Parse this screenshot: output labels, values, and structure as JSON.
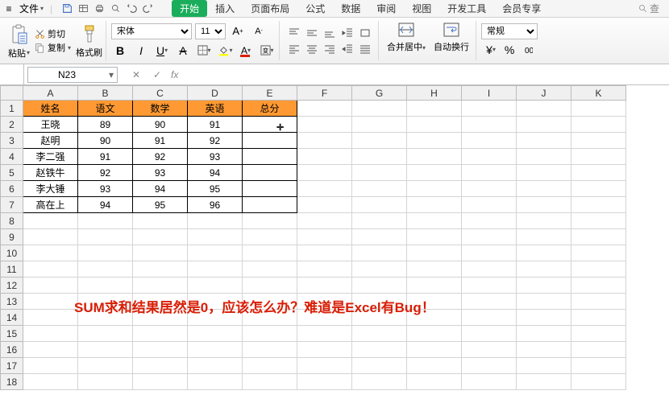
{
  "menubar": {
    "file_label": "文件",
    "quick": {
      "save": "save",
      "undo": "undo",
      "redo": "redo",
      "print": "print"
    },
    "tabs": [
      "开始",
      "插入",
      "页面布局",
      "公式",
      "数据",
      "审阅",
      "视图",
      "开发工具",
      "会员专享"
    ],
    "active_tab_index": 0,
    "search_label": "查"
  },
  "ribbon": {
    "paste_label": "粘贴",
    "cut_label": "剪切",
    "copy_label": "复制",
    "format_painter_label": "格式刷",
    "font_name": "宋体",
    "font_size": "11",
    "merge_label": "合并居中",
    "wrap_label": "自动换行",
    "number_format_label": "常规"
  },
  "namebox": {
    "cell_ref": "N23",
    "fx_label": "fx"
  },
  "grid": {
    "col_headers": [
      "A",
      "B",
      "C",
      "D",
      "E",
      "F",
      "G",
      "H",
      "I",
      "J",
      "K"
    ],
    "row_count": 18,
    "data": {
      "headers": [
        "姓名",
        "语文",
        "数学",
        "英语",
        "总分"
      ],
      "rows": [
        {
          "name": "王晓",
          "chinese": "89",
          "math": "90",
          "english": "91",
          "total": ""
        },
        {
          "name": "赵明",
          "chinese": "90",
          "math": "91",
          "english": "92",
          "total": ""
        },
        {
          "name": "李二强",
          "chinese": "91",
          "math": "92",
          "english": "93",
          "total": ""
        },
        {
          "name": "赵铁牛",
          "chinese": "92",
          "math": "93",
          "english": "94",
          "total": ""
        },
        {
          "name": "李大锤",
          "chinese": "93",
          "math": "94",
          "english": "95",
          "total": ""
        },
        {
          "name": "高在上",
          "chinese": "94",
          "math": "95",
          "english": "96",
          "total": ""
        }
      ]
    }
  },
  "overlay": {
    "warning_text": "SUM求和结果居然是0，应该怎么办？难道是Excel有Bug！"
  },
  "icons": {
    "chevron_down": "▾",
    "hamburger": "≡"
  }
}
